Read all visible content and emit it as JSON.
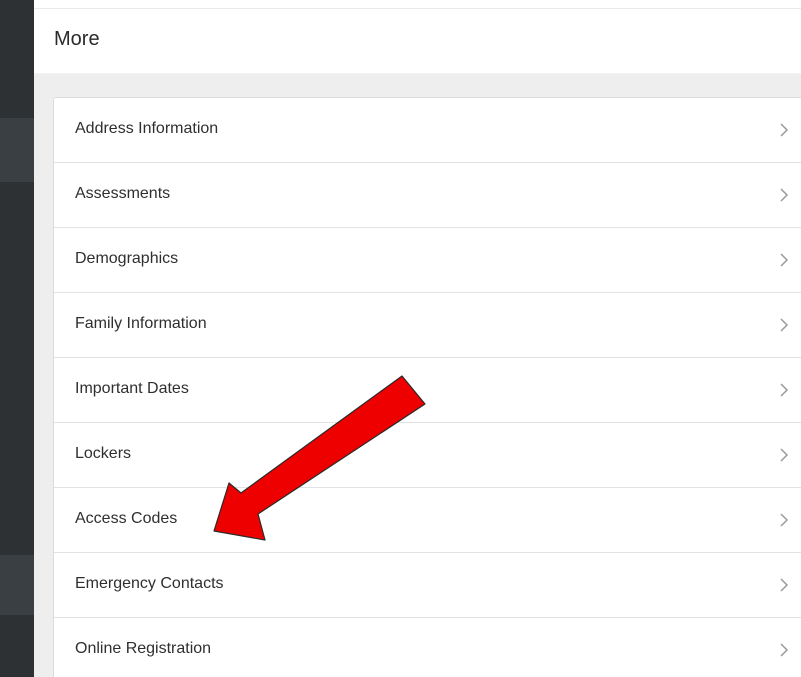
{
  "header": {
    "title": "More"
  },
  "menu": {
    "items": [
      {
        "label": "Address Information",
        "icon": "chevron-right-icon"
      },
      {
        "label": "Assessments",
        "icon": "chevron-right-icon"
      },
      {
        "label": "Demographics",
        "icon": "chevron-right-icon"
      },
      {
        "label": "Family Information",
        "icon": "chevron-right-icon"
      },
      {
        "label": "Important Dates",
        "icon": "chevron-right-icon"
      },
      {
        "label": "Lockers",
        "icon": "chevron-right-icon"
      },
      {
        "label": "Access Codes",
        "icon": "chevron-right-icon"
      },
      {
        "label": "Emergency Contacts",
        "icon": "chevron-right-icon"
      },
      {
        "label": "Online Registration",
        "icon": "chevron-right-icon"
      }
    ]
  },
  "annotation": {
    "icon": "red-arrow-icon",
    "color": "#ee0000",
    "points_to": "Access Codes"
  },
  "colors": {
    "rail": "#2d3134",
    "background": "#eeeeee",
    "card": "#ffffff",
    "text": "#2f2f2f",
    "chevron": "#9a9a9a"
  }
}
